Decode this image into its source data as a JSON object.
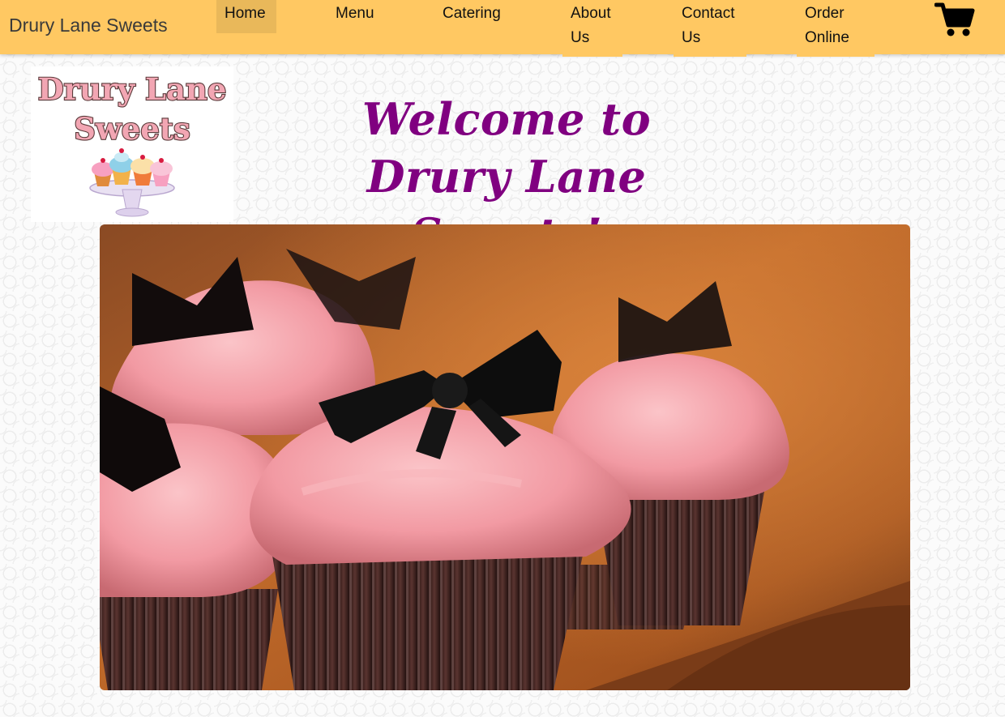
{
  "navbar": {
    "brand": "Drury Lane Sweets",
    "items": [
      {
        "label": "Home",
        "active": true
      },
      {
        "label": "Menu"
      },
      {
        "label": "Catering"
      },
      {
        "label": "About Us"
      },
      {
        "label": "Contact Us"
      },
      {
        "label": "Order Online"
      }
    ],
    "cart_icon": "shopping-cart-icon"
  },
  "logo": {
    "line1": "Drury Lane",
    "line2": "Sweets",
    "icon": "cupcake-stand-icon"
  },
  "main": {
    "heading": "Welcome to Drury Lane Sweets!",
    "hero_image": "cupcakes-with-black-bows-photo"
  },
  "colors": {
    "navbar_bg": "#ffc862",
    "active_item_bg": "#e9b85a",
    "heading": "#800080",
    "logo_text": "#f2a6b3"
  }
}
